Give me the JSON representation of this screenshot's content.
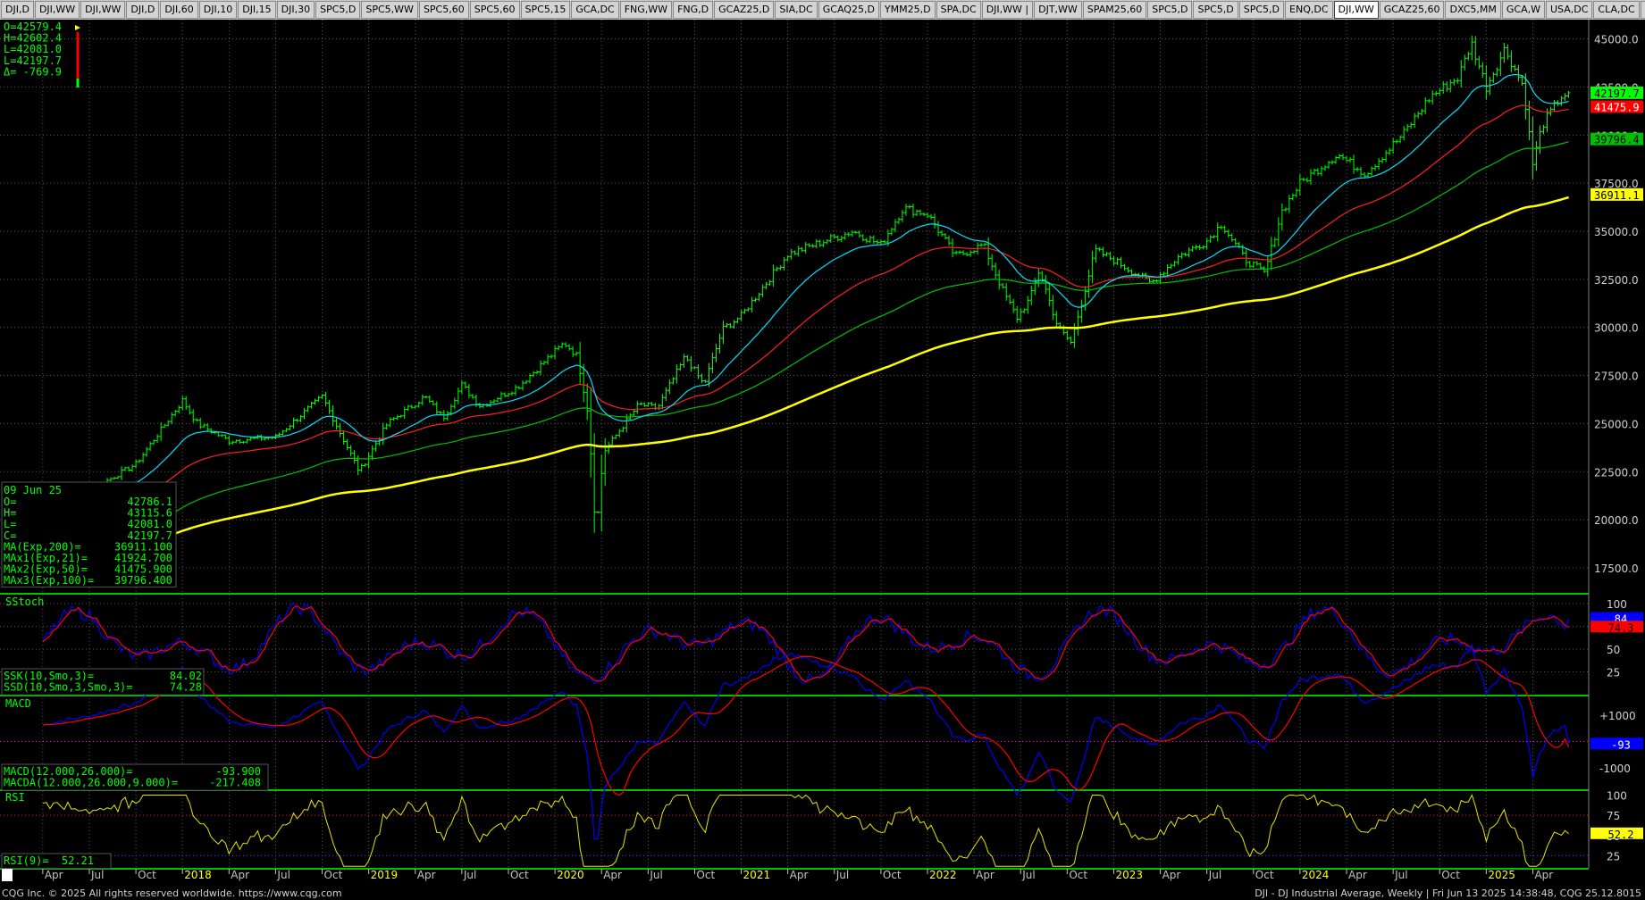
{
  "tabs": [
    "DJI,D",
    "DJI,WW",
    "DJI,WW",
    "DJI,D",
    "DJI,60",
    "DJI,10",
    "DJI,15",
    "DJI,30",
    "SPC5,D",
    "SPC5,WW",
    "SPC5,60",
    "SPC5,60",
    "SPC5,15",
    "GCA,DC",
    "FNG,WW",
    "FNG,D",
    "GCAZ25,D",
    "SIA,DC",
    "GCAQ25,D",
    "YMM25,D",
    "SPA,DC",
    "DJI,WW |",
    "DJT,WW",
    "SPAM25,60",
    "SPC5,D",
    "SPC5,D",
    "SPC5,D",
    "ENQ,DC",
    "DJI,WW",
    "GCAZ25,60",
    "DXC5,MM",
    "GCA,W",
    "USA,DC",
    "CLA,DC",
    "+"
  ],
  "active_tab": 28,
  "colors": {
    "bars": "#00ff00",
    "ma200": "#ffff00",
    "ma21": "#00e0ff",
    "ma50": "#ff2020",
    "ma100": "#00c000",
    "k": "#0000ff",
    "d": "#ff0000",
    "rsi": "#e6e600",
    "grid": "#555555"
  },
  "info_box": {
    "lines": [
      "O=42579.4",
      "H=42602.4",
      "L=42081.0",
      "L=42197.7",
      "Δ=  -769.9"
    ]
  },
  "cursor_box": {
    "date": "09 Jun 25",
    "rows": [
      [
        "O=",
        "42786.1"
      ],
      [
        "H=",
        "43115.6"
      ],
      [
        "L=",
        "42081.0"
      ],
      [
        "C=",
        "42197.7"
      ],
      [
        "MA(Exp,200)=",
        "36911.100"
      ],
      [
        "MAx1(Exp,21)=",
        "41924.700"
      ],
      [
        "MAx2(Exp,50)=",
        "41475.900"
      ],
      [
        "MAx3(Exp,100)=",
        "39796.400"
      ]
    ]
  },
  "sstoch": {
    "title": "SStoch",
    "rows": [
      [
        "SSK(10,Smo,3)=",
        "84.02"
      ],
      [
        "SSD(10,Smo,3,Smo,3)=",
        "74.28"
      ]
    ],
    "k_last": "84",
    "d_last": "74.3"
  },
  "macd": {
    "title": "MACD",
    "rows": [
      [
        "MACD(12.000,26.000)=",
        "-93.900"
      ],
      [
        "MACDA(12.000,26.000,9.000)=",
        "-217.408"
      ]
    ],
    "last": "-93"
  },
  "rsi": {
    "title": "RSI",
    "rows": [
      [
        "RSI(9)=",
        "52.21"
      ]
    ],
    "last": "52.2"
  },
  "price_tags": [
    {
      "value": "42197.7",
      "color": "#00ff00",
      "text": "#000000"
    },
    {
      "value": "41475.9",
      "color": "#ff0000",
      "text": "#ffffff"
    },
    {
      "value": "39796.4",
      "color": "#00c000",
      "text": "#000000"
    },
    {
      "value": "36911.1",
      "color": "#ffff00",
      "text": "#000000"
    }
  ],
  "chart_data": [
    {
      "type": "ohlc",
      "title": "DJI - DJ Industrial Average, Weekly",
      "x_labels": [
        "Apr",
        "Jul",
        "Oct",
        "2018",
        "Apr",
        "Jul",
        "Oct",
        "2019",
        "Apr",
        "Jul",
        "Oct",
        "2020",
        "Apr",
        "Jul",
        "Oct",
        "2021",
        "Apr",
        "Jul",
        "Oct",
        "2022",
        "Apr",
        "Jul",
        "Oct",
        "2023",
        "Apr",
        "Jul",
        "Oct",
        "2024",
        "Apr",
        "Jul",
        "Oct",
        "2025",
        "Apr"
      ],
      "y_ticks": [
        "17500.0",
        "20000.0",
        "22500.0",
        "25000.0",
        "27500.0",
        "30000.0",
        "32500.0",
        "35000.0",
        "37500.0",
        "40000.0",
        "42500.0",
        "45000.0"
      ],
      "ylim": [
        16200,
        46000
      ],
      "close_path": [
        [
          2017.25,
          20650
        ],
        [
          2017.5,
          21500
        ],
        [
          2017.75,
          22900
        ],
        [
          2018.0,
          26200
        ],
        [
          2018.08,
          25000
        ],
        [
          2018.25,
          24100
        ],
        [
          2018.5,
          24300
        ],
        [
          2018.75,
          26400
        ],
        [
          2018.95,
          22500
        ],
        [
          2019.1,
          25000
        ],
        [
          2019.3,
          26400
        ],
        [
          2019.4,
          25300
        ],
        [
          2019.5,
          27000
        ],
        [
          2019.6,
          25900
        ],
        [
          2019.8,
          26900
        ],
        [
          2020.05,
          29200
        ],
        [
          2020.12,
          28500
        ],
        [
          2020.18,
          25400
        ],
        [
          2020.22,
          19200
        ],
        [
          2020.26,
          23500
        ],
        [
          2020.45,
          26000
        ],
        [
          2020.55,
          25800
        ],
        [
          2020.7,
          28500
        ],
        [
          2020.8,
          27000
        ],
        [
          2020.9,
          29900
        ],
        [
          2021.0,
          30600
        ],
        [
          2021.25,
          33800
        ],
        [
          2021.45,
          34500
        ],
        [
          2021.6,
          35000
        ],
        [
          2021.75,
          34300
        ],
        [
          2021.87,
          36200
        ],
        [
          2022.0,
          35900
        ],
        [
          2022.15,
          33700
        ],
        [
          2022.3,
          34300
        ],
        [
          2022.4,
          32000
        ],
        [
          2022.48,
          30500
        ],
        [
          2022.55,
          31500
        ],
        [
          2022.6,
          33000
        ],
        [
          2022.7,
          30000
        ],
        [
          2022.77,
          29200
        ],
        [
          2022.9,
          34000
        ],
        [
          2023.0,
          33500
        ],
        [
          2023.2,
          32300
        ],
        [
          2023.35,
          33700
        ],
        [
          2023.5,
          34500
        ],
        [
          2023.58,
          35400
        ],
        [
          2023.7,
          33600
        ],
        [
          2023.81,
          32800
        ],
        [
          2023.9,
          36000
        ],
        [
          2024.0,
          37500
        ],
        [
          2024.2,
          39000
        ],
        [
          2024.35,
          38000
        ],
        [
          2024.55,
          40000
        ],
        [
          2024.7,
          42000
        ],
        [
          2024.85,
          43000
        ],
        [
          2024.92,
          44800
        ],
        [
          2025.0,
          42500
        ],
        [
          2025.1,
          44500
        ],
        [
          2025.2,
          42500
        ],
        [
          2025.25,
          38500
        ],
        [
          2025.3,
          40500
        ],
        [
          2025.4,
          42000
        ],
        [
          2025.45,
          42197.7
        ]
      ],
      "ema21_last": 41924.7,
      "ema50_last": 41475.9,
      "ema100_last": 39796.4,
      "ema200_last": 36911.1
    },
    {
      "type": "line",
      "title": "SStoch",
      "y_ticks": [
        "25",
        "50",
        "75",
        "100"
      ],
      "ylim": [
        0,
        110
      ],
      "series": [
        {
          "name": "SSK(10,Smo,3)",
          "last": 84.02
        },
        {
          "name": "SSD(10,Smo,3,Smo,3)",
          "last": 74.28
        }
      ]
    },
    {
      "type": "line",
      "title": "MACD",
      "y_ticks": [
        "-1000",
        "+1000"
      ],
      "ylim": [
        -1800,
        1700
      ],
      "series": [
        {
          "name": "MACD(12.000,26.000)",
          "last": -93.9
        },
        {
          "name": "MACDA(12.000,26.000,9.000)",
          "last": -217.408
        }
      ]
    },
    {
      "type": "line",
      "title": "RSI",
      "y_ticks": [
        "25",
        "50",
        "75",
        "100"
      ],
      "ylim": [
        10,
        105
      ],
      "series": [
        {
          "name": "RSI(9)",
          "last": 52.21
        }
      ]
    }
  ],
  "footer": {
    "left": "CQG Inc. © 2025 All rights reserved worldwide. https://www.cqg.com",
    "right": "DJI - DJ Industrial Average, Weekly | Fri Jun 13 2025 14:38:48, CQG 25.12.8015"
  }
}
